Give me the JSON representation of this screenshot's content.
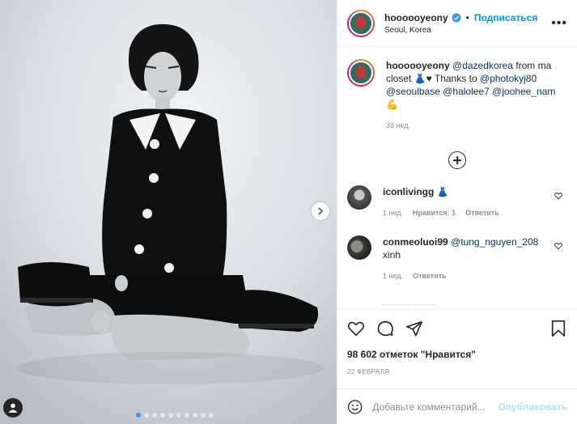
{
  "header": {
    "username": "hoooooyeony",
    "separator": "•",
    "follow_label": "Подписаться",
    "location": "Seoul, Korea",
    "more_label": "•••"
  },
  "caption": {
    "username": "hoooooyeony",
    "text_parts": [
      "@dazedkorea",
      " from ma closet ",
      "👗♥",
      " Thanks to ",
      "@photokyj80",
      " ",
      "@seoulbase",
      " ",
      "@halolee7",
      " ",
      "@joohee_nam",
      " ",
      "💪"
    ],
    "time": "33 нед."
  },
  "comments": [
    {
      "username": "iconlivingg",
      "text": "👗",
      "time": "1 нед.",
      "likes": "Нравится: 1",
      "reply": "Ответить"
    },
    {
      "username": "conmeoluoi99",
      "mention": "@tung_nguyen_208",
      "text": "xinh",
      "time": "1 нед.",
      "reply": "Ответить"
    }
  ],
  "post": {
    "likes": "98 602 отметок \"Нравится\"",
    "date": "22 ФЕВРАЛЯ"
  },
  "add_comment": {
    "placeholder": "Добавьте комментарий...",
    "publish_label": "Опубликовать"
  },
  "carousel": {
    "total": 10,
    "active_index": 0
  },
  "colors": {
    "accent": "#0095f6",
    "carousel_active": "#3897f0",
    "publish_disabled": "#b2dffc"
  },
  "icons": [
    "verified-badge-icon",
    "chevron-right-icon",
    "user-tag-icon",
    "plus-circle-icon",
    "heart-icon",
    "comment-icon",
    "share-icon",
    "bookmark-icon",
    "emoji-icon",
    "more-icon"
  ]
}
